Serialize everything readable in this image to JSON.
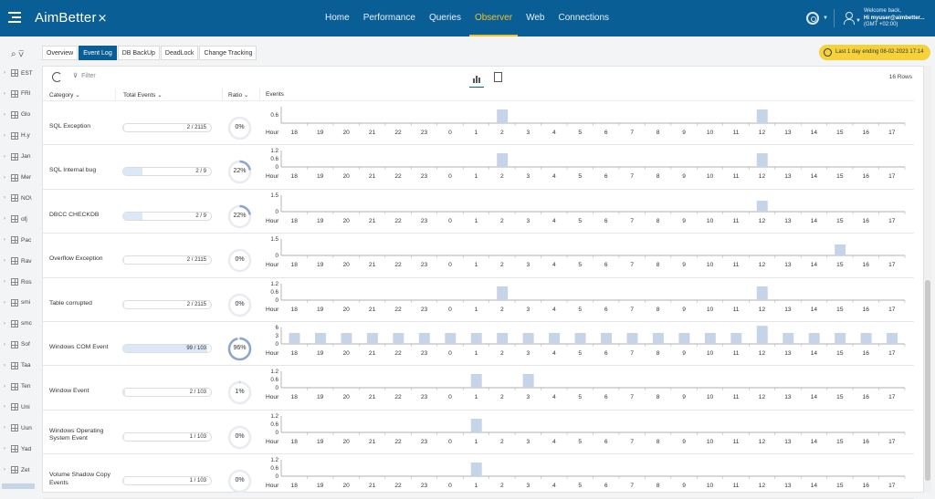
{
  "header": {
    "logo_text": "AimBetter",
    "nav": [
      "Home",
      "Performance",
      "Queries",
      "Observer",
      "Web",
      "Connections"
    ],
    "active_nav": "Observer",
    "welcome_line": "Welcome back,",
    "user_line": "Hi myuser@aimbetter...",
    "tz_line": "(GMT +02:00)"
  },
  "sidebar": {
    "items": [
      "EST",
      "FRI",
      "Glo",
      "H.y",
      "Jan",
      "Mer",
      "NO\\",
      "ofj",
      "Pac",
      "Rav",
      "Ros",
      "smi",
      "smc",
      "Sof",
      "Taa",
      "Ten",
      "Uni",
      "Uun",
      "Yad",
      "Zet"
    ]
  },
  "tabs": [
    "Overview",
    "Event Log",
    "DB BackUp",
    "DeadLock",
    "Change Tracking"
  ],
  "active_tab": "Event Log",
  "date_range": "Last 1 day ending  08-02-2023 17:14",
  "toolbar": {
    "filter_label": "Filter",
    "row_count": "16 Rows"
  },
  "columns": {
    "category": "Category",
    "total": "Total Events",
    "ratio": "Ratio",
    "events": "Events"
  },
  "hour_label": "Hour",
  "hours": [
    "18",
    "19",
    "20",
    "21",
    "22",
    "23",
    "0",
    "1",
    "2",
    "3",
    "4",
    "5",
    "6",
    "7",
    "8",
    "9",
    "10",
    "11",
    "12",
    "13",
    "14",
    "15",
    "16",
    "17"
  ],
  "colors": {
    "brand": "#0a5e96",
    "active_nav": "#f2c02c",
    "bar": "#c5d4e8",
    "ratio_arc": "#8aa7c9",
    "date_pill": "#f6d23a"
  },
  "events": [
    {
      "category": "SQL Exception",
      "total_text": "2 / 2115",
      "fill_fraction": 0.001,
      "ratio_text": "0%",
      "ratio": 0.0,
      "yticks": [
        "0.6"
      ],
      "ymax": 1.2,
      "counts": [
        0,
        0,
        0,
        0,
        0,
        0,
        0,
        0,
        1,
        0,
        0,
        0,
        0,
        0,
        0,
        0,
        0,
        0,
        1,
        0,
        0,
        0,
        0,
        0
      ]
    },
    {
      "category": "SQL Internal bug",
      "total_text": "2 / 9",
      "fill_fraction": 0.22,
      "ratio_text": "22%",
      "ratio": 0.22,
      "yticks": [
        "1.2",
        "0.6",
        "0"
      ],
      "ymax": 1.2,
      "counts": [
        0,
        0,
        0,
        0,
        0,
        0,
        0,
        0,
        1,
        0,
        0,
        0,
        0,
        0,
        0,
        0,
        0,
        0,
        1,
        0,
        0,
        0,
        0,
        0
      ]
    },
    {
      "category": "DBCC CHECKDB",
      "total_text": "2 / 9",
      "fill_fraction": 0.22,
      "ratio_text": "22%",
      "ratio": 0.22,
      "yticks": [
        "1.5",
        "0"
      ],
      "ymax": 1.5,
      "counts": [
        0,
        0,
        0,
        0,
        0,
        0,
        0,
        0,
        0,
        0,
        0,
        0,
        0,
        0,
        0,
        0,
        0,
        0,
        1,
        0,
        0,
        0,
        0,
        0
      ]
    },
    {
      "category": "Overflow Exception",
      "total_text": "2 / 2115",
      "fill_fraction": 0.001,
      "ratio_text": "0%",
      "ratio": 0.0,
      "yticks": [
        "1.5",
        "0"
      ],
      "ymax": 1.5,
      "counts": [
        0,
        0,
        0,
        0,
        0,
        0,
        0,
        0,
        0,
        0,
        0,
        0,
        0,
        0,
        0,
        0,
        0,
        0,
        0,
        0,
        0,
        1,
        0,
        0
      ]
    },
    {
      "category": "Table corrupted",
      "total_text": "2 / 2115",
      "fill_fraction": 0.001,
      "ratio_text": "0%",
      "ratio": 0.0,
      "yticks": [
        "1.2",
        "0.6",
        "0"
      ],
      "ymax": 1.2,
      "counts": [
        0,
        0,
        0,
        0,
        0,
        0,
        0,
        0,
        1,
        0,
        0,
        0,
        0,
        0,
        0,
        0,
        0,
        0,
        1,
        0,
        0,
        0,
        0,
        0
      ]
    },
    {
      "category": "Windows COM Event",
      "total_text": "99 / 103",
      "fill_fraction": 0.96,
      "ratio_text": "96%",
      "ratio": 0.96,
      "yticks": [
        "6",
        "3",
        "0"
      ],
      "ymax": 6,
      "counts": [
        4,
        4,
        4,
        4,
        4,
        4,
        4,
        4,
        4,
        4,
        4,
        4,
        4,
        4,
        4,
        4,
        4,
        4,
        7,
        4,
        4,
        4,
        4,
        4
      ]
    },
    {
      "category": "Window Event",
      "total_text": "2 / 103",
      "fill_fraction": 0.02,
      "ratio_text": "1%",
      "ratio": 0.01,
      "yticks": [
        "1.2",
        "0.6",
        "0"
      ],
      "ymax": 1.2,
      "counts": [
        0,
        0,
        0,
        0,
        0,
        0,
        0,
        1,
        0,
        1,
        0,
        0,
        0,
        0,
        0,
        0,
        0,
        0,
        0,
        0,
        0,
        0,
        0,
        0
      ]
    },
    {
      "category": "Windows Operating System Event",
      "total_text": "1 / 103",
      "fill_fraction": 0.01,
      "ratio_text": "0%",
      "ratio": 0.0,
      "yticks": [
        "1.2",
        "0.6",
        "0"
      ],
      "ymax": 1.2,
      "counts": [
        0,
        0,
        0,
        0,
        0,
        0,
        0,
        1,
        0,
        0,
        0,
        0,
        0,
        0,
        0,
        0,
        0,
        0,
        0,
        0,
        0,
        0,
        0,
        0
      ]
    },
    {
      "category": "Volume Shadow Copy Events",
      "total_text": "1 / 103",
      "fill_fraction": 0.01,
      "ratio_text": "0%",
      "ratio": 0.0,
      "yticks": [
        "1.2",
        "0.6",
        "0"
      ],
      "ymax": 1.2,
      "counts": [
        0,
        0,
        0,
        0,
        0,
        0,
        0,
        1,
        0,
        0,
        0,
        0,
        0,
        0,
        0,
        0,
        0,
        0,
        0,
        0,
        0,
        0,
        0,
        0
      ]
    }
  ]
}
